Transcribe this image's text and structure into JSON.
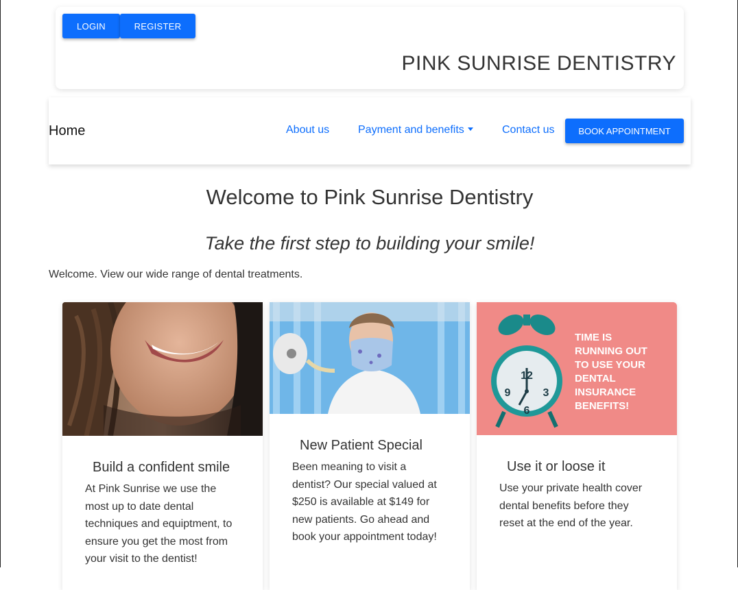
{
  "header": {
    "login_label": "LOGIN",
    "register_label": "REGISTER",
    "site_title": "PINK SUNRISE DENTISTRY"
  },
  "nav": {
    "home": "Home",
    "about": "About us",
    "payment": "Payment and benefits",
    "contact": "Contact us",
    "book": "BOOK APPOINTMENT"
  },
  "main": {
    "title": "Welcome to Pink Sunrise Dentistry",
    "tagline": "Take the first step to building your smile!",
    "intro": "Welcome. View our wide range of dental treatments."
  },
  "cards": [
    {
      "title": "Build a confident smile",
      "text": [
        "At Pink Sunrise we use the",
        "most up to date dental",
        "techniques and equiptment, to",
        "ensure you get the most from",
        "your visit to the dentist!"
      ]
    },
    {
      "title": "New Patient Special",
      "text": [
        "Been meaning to visit a",
        "dentist? Our special valued at",
        "$250 is available at $149 for",
        "new patients. Go ahead and",
        "book your appointment today!"
      ]
    },
    {
      "title": "Use it or loose it",
      "text": [
        "Use your private health cover",
        "dental benefits before they",
        "reset at the end of the year."
      ],
      "image_text": [
        "TIME IS",
        "RUNNING OUT",
        "TO USE YOUR",
        "DENTAL",
        "INSURANCE",
        "BENEFITS!"
      ],
      "clock_numerals": [
        "12",
        "3",
        "6",
        "9"
      ]
    }
  ],
  "colors": {
    "primary": "#0d6efd",
    "text": "#333333",
    "card3_bg": "#f28c89"
  }
}
